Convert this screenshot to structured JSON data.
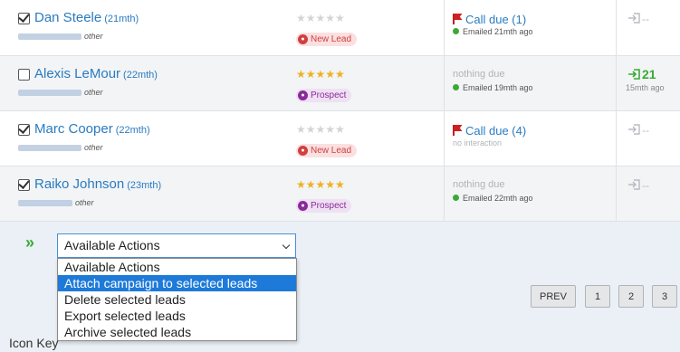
{
  "leads": [
    {
      "name": "Dan Steele",
      "age": "(21mth)",
      "checked": true,
      "phone_label": "other",
      "stars": "★★★★★",
      "rating": 0,
      "status": "New Lead",
      "status_kind": "newlead",
      "due": "Call due (1)",
      "due_kind": "active",
      "interaction": "Emailed 21mth ago",
      "interaction_dot": true,
      "activity_dash": "--",
      "activity_count": "",
      "activity_time": ""
    },
    {
      "name": "Alexis LeMour",
      "age": "(22mth)",
      "checked": false,
      "phone_label": "other",
      "stars": "★★★★★",
      "rating": 5,
      "status": "Prospect",
      "status_kind": "prospect",
      "due": "nothing due",
      "due_kind": "none",
      "interaction": "Emailed 19mth ago",
      "interaction_dot": true,
      "activity_dash": "",
      "activity_count": "21",
      "activity_time": "15mth ago"
    },
    {
      "name": "Marc Cooper",
      "age": "(22mth)",
      "checked": true,
      "phone_label": "other",
      "stars": "★★★★★",
      "rating": 0,
      "status": "New Lead",
      "status_kind": "newlead",
      "due": "Call due (4)",
      "due_kind": "active",
      "interaction": "no interaction",
      "interaction_dot": false,
      "activity_dash": "--",
      "activity_count": "",
      "activity_time": ""
    },
    {
      "name": "Raiko Johnson",
      "age": "(23mth)",
      "checked": true,
      "phone_label": "other",
      "stars": "★★★★★",
      "rating": 5,
      "status": "Prospect",
      "status_kind": "prospect",
      "due": "nothing due",
      "due_kind": "none",
      "interaction": "Emailed 22mth ago",
      "interaction_dot": true,
      "activity_dash": "--",
      "activity_count": "",
      "activity_time": ""
    }
  ],
  "actions": {
    "chevrons": "»",
    "selected": "Available Actions",
    "options": [
      "Available Actions",
      "Attach campaign to selected leads",
      "Delete selected leads",
      "Export selected leads",
      "Archive selected leads"
    ],
    "highlighted_index": 1
  },
  "pager": {
    "prev": "PREV",
    "pages": [
      "1",
      "2",
      "3"
    ]
  },
  "icon_key": "Icon Key",
  "colors": {
    "link": "#2a7bc0",
    "green": "#3aaa35",
    "flag": "#d02020",
    "star": "#f0b020",
    "highlight": "#1e7ad9"
  }
}
